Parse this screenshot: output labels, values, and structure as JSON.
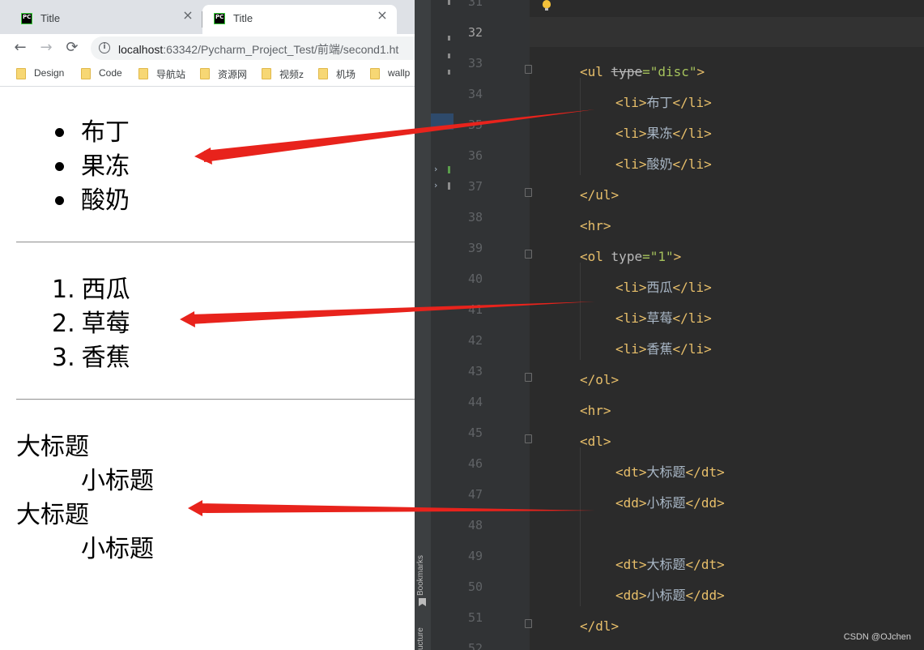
{
  "browser": {
    "tabs": [
      {
        "title": "Title",
        "favicon": "PC",
        "close": "×"
      },
      {
        "title": "Title",
        "favicon": "PC",
        "close": "×"
      }
    ],
    "nav": {
      "back": "←",
      "forward": "→",
      "reload": "⟳"
    },
    "address": {
      "info_icon": "i",
      "host": "localhost",
      "rest": ":63342/Pycharm_Project_Test/前端/second1.ht"
    },
    "bookmarks": [
      "Design",
      "Code",
      "导航站",
      "资源网",
      "视频z",
      "机场",
      "wallp"
    ],
    "page": {
      "ul_items": [
        "布丁",
        "果冻",
        "酸奶"
      ],
      "ol_items": [
        {
          "num": "1.",
          "text": "西瓜"
        },
        {
          "num": "2.",
          "text": "草莓"
        },
        {
          "num": "3.",
          "text": "香蕉"
        }
      ],
      "dl": [
        {
          "dt": "大标题",
          "dd": "小标题"
        },
        {
          "dt": "大标题",
          "dd": "小标题"
        }
      ]
    }
  },
  "ide": {
    "line_numbers": [
      "31",
      "32",
      "33",
      "34",
      "35",
      "36",
      "37",
      "38",
      "39",
      "40",
      "41",
      "42",
      "43",
      "44",
      "45",
      "46",
      "47",
      "48",
      "49",
      "50",
      "51",
      "52"
    ],
    "current_line": "32",
    "code": {
      "l33": {
        "open": "<ul",
        "attr": "type",
        "eq": "=",
        "val": "\"disc\"",
        "close": ">"
      },
      "l34": {
        "open": "<li>",
        "text": "布丁",
        "close": "</li>"
      },
      "l35": {
        "open": "<li>",
        "text": "果冻",
        "close": "</li>"
      },
      "l36": {
        "open": "<li>",
        "text": "酸奶",
        "close": "</li>"
      },
      "l37": "</ul>",
      "l38": "<hr>",
      "l39": {
        "open": "<ol",
        "attr": "type",
        "eq": "=",
        "val": "\"1\"",
        "close": ">"
      },
      "l40": {
        "open": "<li>",
        "text": "西瓜",
        "close": "</li>"
      },
      "l41": {
        "open": "<li>",
        "text": "草莓",
        "close": "</li>"
      },
      "l42": {
        "open": "<li>",
        "text": "香蕉",
        "close": "</li>"
      },
      "l43": "</ol>",
      "l44": "<hr>",
      "l45": "<dl>",
      "l46": {
        "open": "<dt>",
        "text": "大标题",
        "close": "</dt>"
      },
      "l47": {
        "open": "<dd>",
        "text": "小标题",
        "close": "</dd>"
      },
      "l49": {
        "open": "<dt>",
        "text": "大标题",
        "close": "</dt>"
      },
      "l50": {
        "open": "<dd>",
        "text": "小标题",
        "close": "</dd>"
      },
      "l51": "</dl>"
    },
    "side_labels": {
      "bookmarks": "Bookmarks",
      "structure": "ucture"
    },
    "watermark": "CSDN @OJchen"
  },
  "colors": {
    "arrow": "#e8231c",
    "tag": "#e8bf6a",
    "attr_value": "#a5c25c",
    "editor_bg": "#2b2b2b"
  }
}
